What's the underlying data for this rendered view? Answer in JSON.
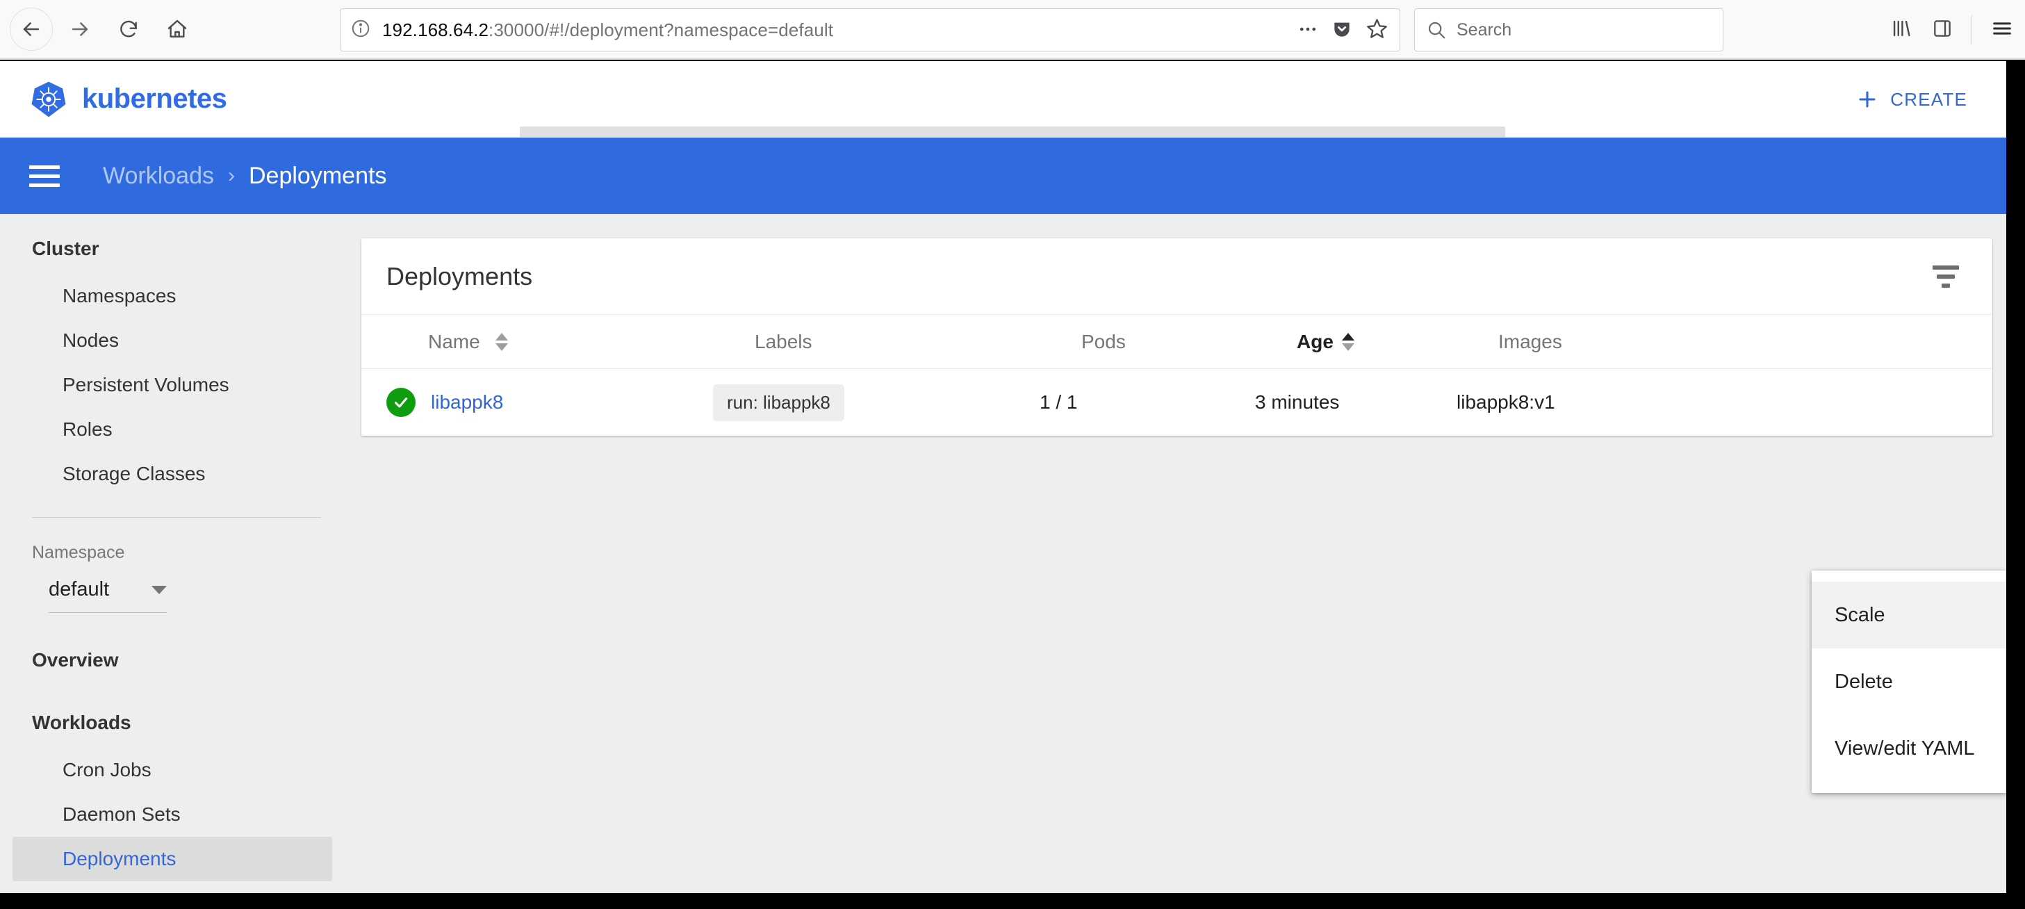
{
  "browser": {
    "url_host": "192.168.64.2",
    "url_rest": ":30000/#!/deployment?namespace=default",
    "search_placeholder": "Search",
    "icons": {
      "back": "back-arrow-icon",
      "forward": "forward-arrow-icon",
      "reload": "reload-icon",
      "home": "home-icon",
      "page_info": "page-info-icon",
      "page_actions": "ellipsis-icon",
      "pocket": "pocket-icon",
      "bookmark": "star-icon",
      "search": "search-icon",
      "library": "library-icon",
      "sidebar": "sidebar-icon",
      "menu": "hamburger-menu-icon"
    }
  },
  "app": {
    "brand": "kubernetes",
    "search_placeholder": "Search",
    "create_label": "CREATE",
    "accent_blue": "#326ce5",
    "breadcrumb_blue": "#2f6bdf"
  },
  "breadcrumb": {
    "parent": "Workloads",
    "separator": "›",
    "current": "Deployments"
  },
  "sidebar": {
    "cluster": {
      "title": "Cluster",
      "items": [
        {
          "label": "Namespaces"
        },
        {
          "label": "Nodes"
        },
        {
          "label": "Persistent Volumes"
        },
        {
          "label": "Roles"
        },
        {
          "label": "Storage Classes"
        }
      ]
    },
    "namespace": {
      "label": "Namespace",
      "value": "default"
    },
    "overview": {
      "title": "Overview"
    },
    "workloads": {
      "title": "Workloads",
      "items": [
        {
          "label": "Cron Jobs",
          "active": false
        },
        {
          "label": "Daemon Sets",
          "active": false
        },
        {
          "label": "Deployments",
          "active": true
        }
      ]
    }
  },
  "main": {
    "card_title": "Deployments",
    "filter_icon": "filter-icon",
    "table": {
      "columns": [
        {
          "label": "Name",
          "sortable": true,
          "active": false
        },
        {
          "label": "Labels",
          "sortable": false,
          "active": false
        },
        {
          "label": "Pods",
          "sortable": false,
          "active": false
        },
        {
          "label": "Age",
          "sortable": true,
          "active": true
        },
        {
          "label": "Images",
          "sortable": false,
          "active": false
        }
      ],
      "rows": [
        {
          "status": "healthy",
          "status_color": "#0f9d0f",
          "name": "libappk8",
          "label_chip": "run: libappk8",
          "pods": "1 / 1",
          "age": "3 minutes",
          "images": "libappk8:v1"
        }
      ]
    }
  },
  "context_menu": {
    "items": [
      {
        "label": "Scale",
        "hovered": true
      },
      {
        "label": "Delete",
        "hovered": false
      },
      {
        "label": "View/edit YAML",
        "hovered": false
      }
    ]
  }
}
